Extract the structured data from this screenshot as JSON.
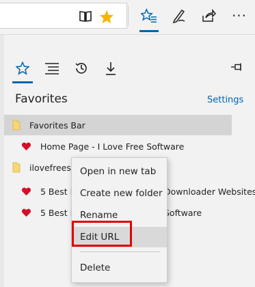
{
  "toolbar": {
    "reading_view_icon": "book-icon",
    "favorite_star_icon": "star-filled-icon",
    "hub_icon": "favorites-hub-icon",
    "notes_icon": "pen-icon",
    "share_icon": "share-icon",
    "more_label": "···"
  },
  "hub": {
    "tabs": [
      "favorites-tab",
      "reading-list-tab",
      "history-tab",
      "downloads-tab"
    ],
    "title": "Favorites",
    "settings_label": "Settings",
    "items": [
      {
        "label": "Favorites Bar",
        "icon": "folder-icon"
      },
      {
        "label": "Home Page - I Love Free Software",
        "icon": "heart-icon"
      },
      {
        "label": "ilovefreeso",
        "icon": "folder-icon"
      },
      {
        "label": "5 Best F",
        "suffix": "Downloader Websites",
        "icon": "heart-icon"
      },
      {
        "label": "5 Best F",
        "suffix": "Software",
        "icon": "heart-icon"
      }
    ]
  },
  "context_menu": {
    "items": [
      "Open in new tab",
      "Create new folder",
      "Rename",
      "Edit URL",
      "Delete"
    ]
  },
  "colors": {
    "accent": "#0063b1",
    "heart": "#d40e2a",
    "star": "#f4b400",
    "highlight_box": "#e00000"
  }
}
